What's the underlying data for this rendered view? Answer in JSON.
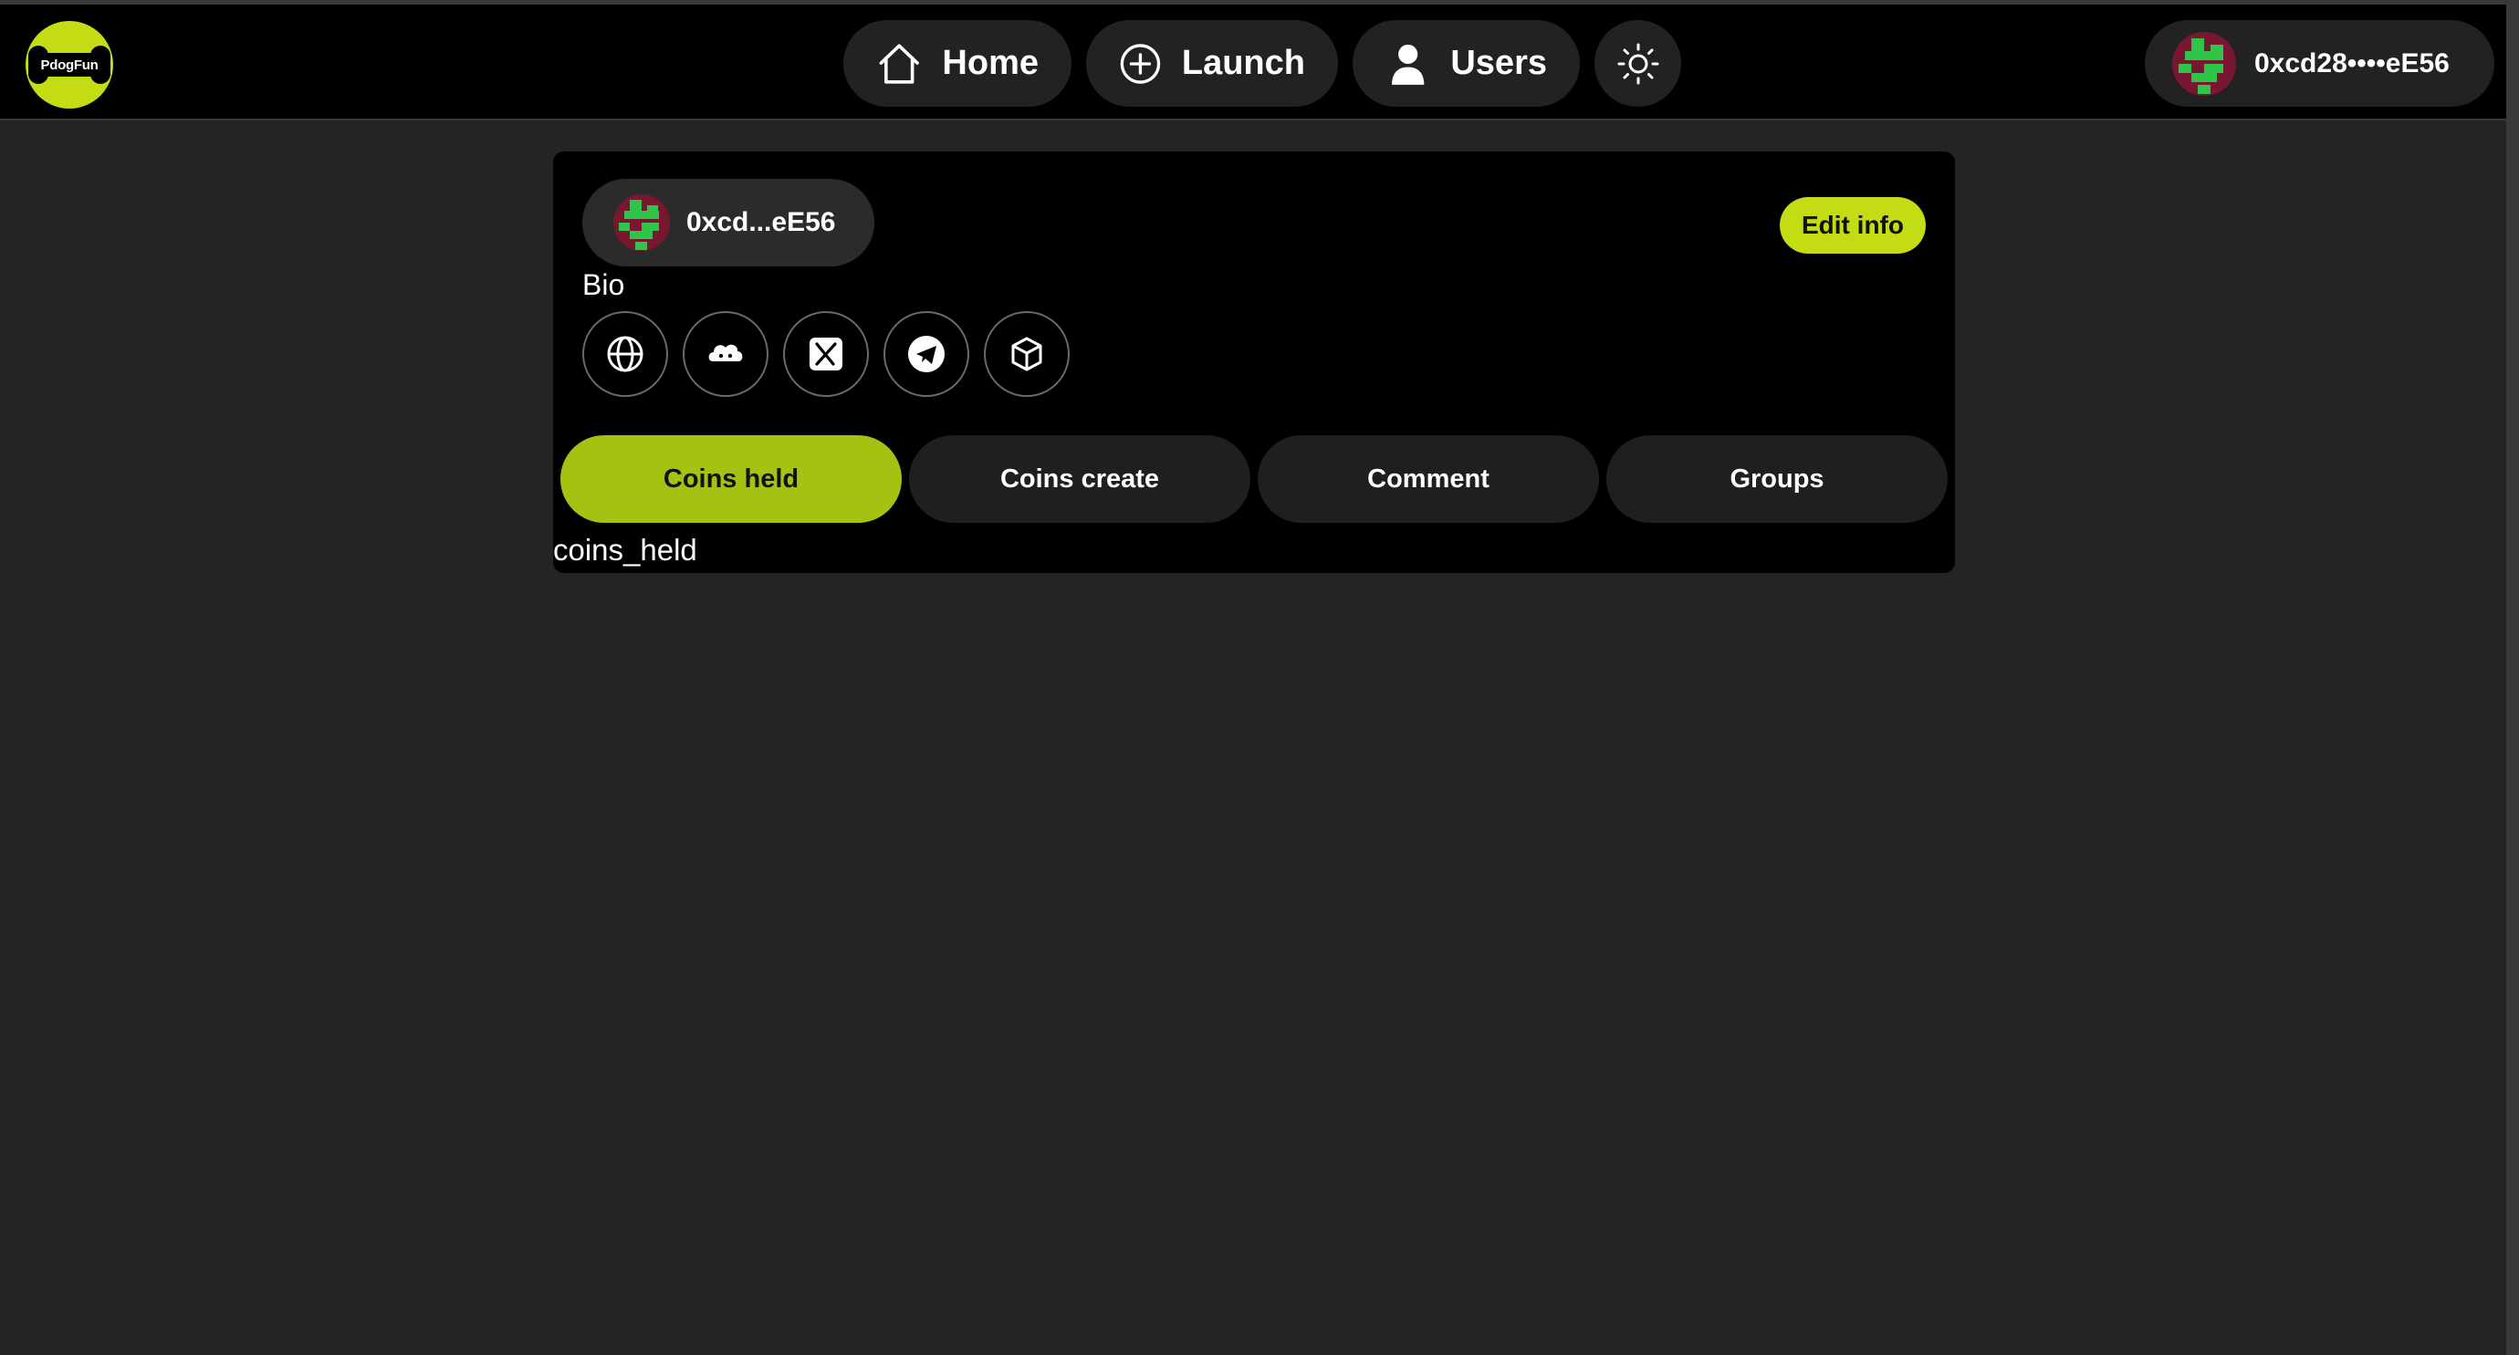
{
  "brand": {
    "logo_text": "PdogFun"
  },
  "nav": {
    "items": [
      {
        "label": "Home",
        "icon": "home-icon"
      },
      {
        "label": "Launch",
        "icon": "plus-circle-icon"
      },
      {
        "label": "Users",
        "icon": "user-icon"
      }
    ],
    "theme_icon": "sun-icon"
  },
  "wallet": {
    "address": "0xcd28••••eE56"
  },
  "profile": {
    "address_short": "0xcd...eE56",
    "edit_label": "Edit info",
    "bio_label": "Bio",
    "socials": [
      "globe-icon",
      "cloud-icon",
      "x-twitter-icon",
      "telegram-icon",
      "cube-icon"
    ]
  },
  "tabs": [
    {
      "label": "Coins held",
      "active": true
    },
    {
      "label": "Coins create",
      "active": false
    },
    {
      "label": "Comment",
      "active": false
    },
    {
      "label": "Groups",
      "active": false
    }
  ],
  "tab_content": {
    "text": "coins_held"
  },
  "colors": {
    "accent": "#c3dc14",
    "active_tab": "#a6c112",
    "background": "#242424",
    "avatar_bg": "#7a1730",
    "avatar_fg": "#2fc44a"
  }
}
